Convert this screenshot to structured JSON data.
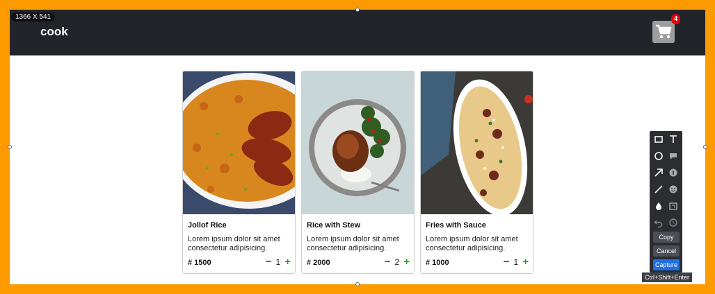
{
  "capture_overlay": {
    "dimensions_label": "1366 X 541",
    "shortcut_hint": "Ctrl+Shift+Enter",
    "buttons": {
      "copy": "Copy",
      "cancel": "Cancel",
      "capture": "Capture"
    },
    "tools": [
      "rectangle-icon",
      "text-icon",
      "ellipse-icon",
      "comment-icon",
      "arrow-icon",
      "number-icon",
      "line-icon",
      "emoji-icon",
      "blur-icon",
      "crop-icon",
      "undo-icon",
      "redo-icon"
    ],
    "colors": {
      "border": "#fd9a00",
      "accent": "#1f6fe5"
    }
  },
  "navbar": {
    "brand": "cook",
    "cart_count": "4",
    "cart_icon": "cart-icon"
  },
  "products": [
    {
      "name": "Jollof Rice",
      "description": "Lorem ipsum dolor sit amet consectetur adipisicing.",
      "price": "# 1500",
      "quantity": "1",
      "minus": "−",
      "plus": "+"
    },
    {
      "name": "Rice with Stew",
      "description": "Lorem ipsum dolor sit amet consectetur adipisicing.",
      "price": "# 2000",
      "quantity": "2",
      "minus": "−",
      "plus": "+"
    },
    {
      "name": "Fries with Sauce",
      "description": "Lorem ipsum dolor sit amet consectetur adipisicing.",
      "price": "# 1000",
      "quantity": "1",
      "minus": "−",
      "plus": "+"
    }
  ]
}
